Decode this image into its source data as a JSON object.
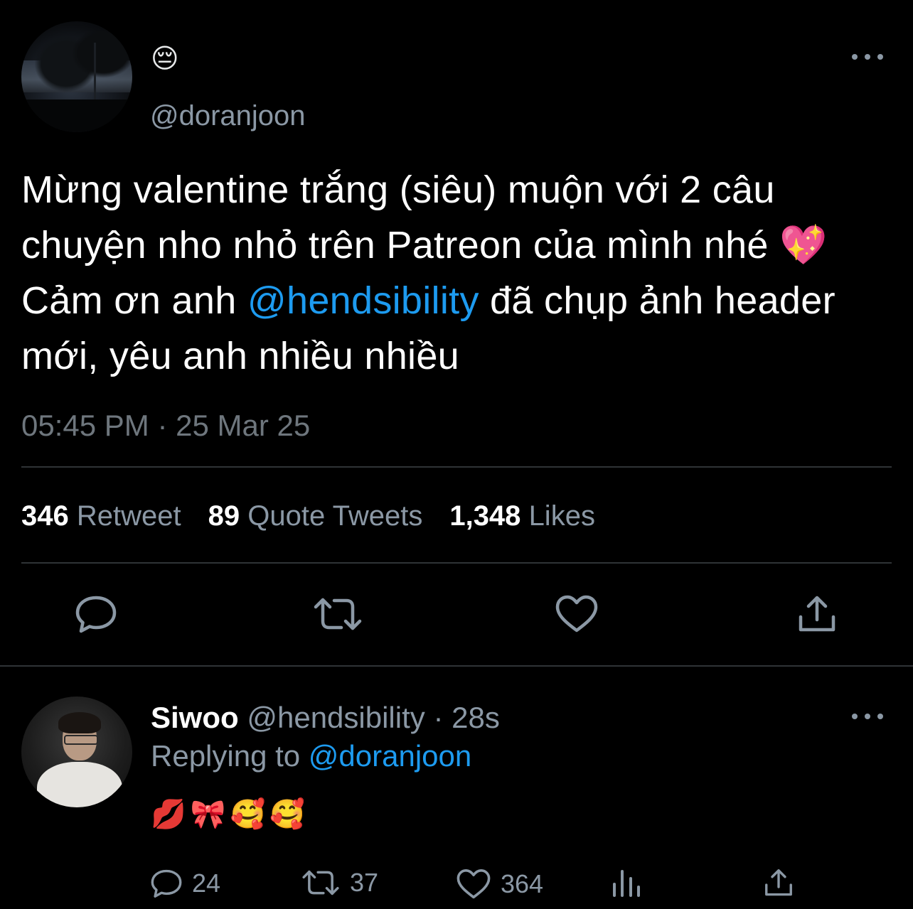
{
  "colors": {
    "background": "#000000",
    "text": "#ffffff",
    "secondary": "#8b98a5",
    "link": "#1d9bf0",
    "divider": "#2f3336"
  },
  "main_tweet": {
    "display_name_emoji": "😔",
    "handle": "@doranjoon",
    "text_part1": "Mừng valentine trắng (siêu) muộn với 2 câu chuyện nho nhỏ trên Patreon của mình nhé 💖 Cảm ơn anh ",
    "mention": "@hendsibility",
    "text_part2": " đã chụp ảnh header mới, yêu anh nhiều nhiều",
    "timestamp": "05:45 PM · 25 Mar 25",
    "stats": {
      "retweets_count": "346",
      "retweets_label": "Retweet",
      "quotes_count": "89",
      "quotes_label": "Quote Tweets",
      "likes_count": "1,348",
      "likes_label": "Likes"
    },
    "actions": [
      "reply-icon",
      "retweet-icon",
      "heart-icon",
      "share-icon"
    ]
  },
  "reply": {
    "name": "Siwoo",
    "handle": "@hendsibility",
    "separator": "·",
    "time": "28s",
    "replying_prefix": "Replying to",
    "replying_to": "@doranjoon",
    "text": "💋🎀🥰🥰",
    "counts": {
      "replies": "24",
      "retweets": "37",
      "likes": "364"
    }
  }
}
